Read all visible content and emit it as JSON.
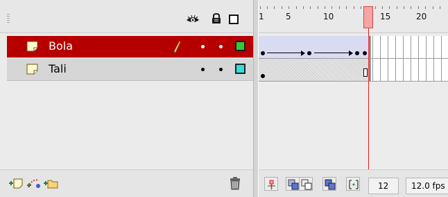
{
  "layers": {
    "items": [
      {
        "name": "Bola",
        "selected": true,
        "outline_color": "#33cc33"
      },
      {
        "name": "Tali",
        "selected": false,
        "outline_color": "#33dddd"
      }
    ],
    "header_icons": [
      "eye-icon",
      "lock-icon",
      "outline-icon"
    ],
    "footer_icons": [
      "add-layer-icon",
      "add-motion-guide-icon",
      "add-folder-icon",
      "trash-icon"
    ]
  },
  "timeline": {
    "ruler": {
      "labels": [
        "1",
        "5",
        "10",
        "15",
        "20"
      ]
    },
    "current_frame": "12",
    "frame_rate": "12.0 fps",
    "playhead_color": "#ea1b1b"
  },
  "colors": {
    "selected_layer_bg": "#b60000",
    "tween_fill": "#d9dbf3"
  }
}
